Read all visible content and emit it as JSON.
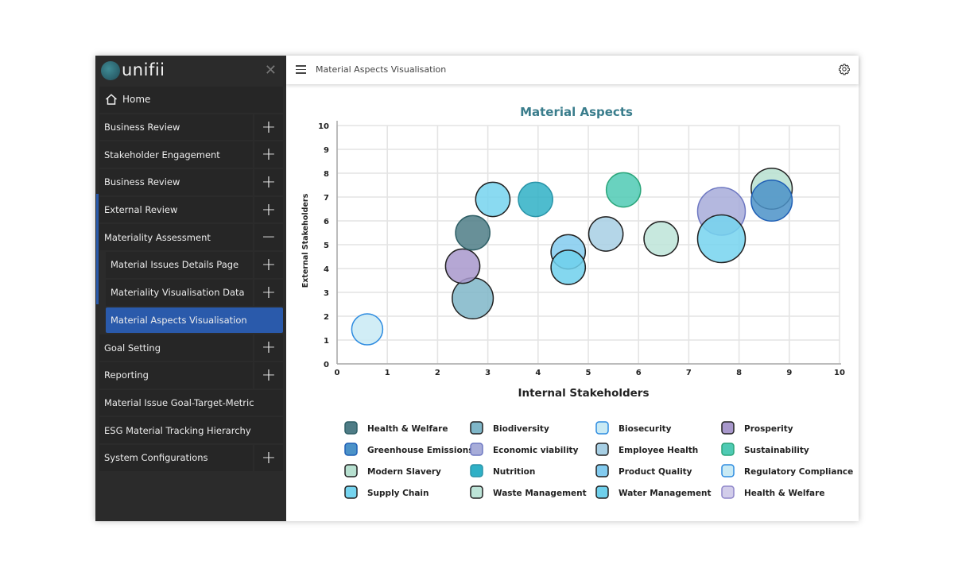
{
  "sidebar": {
    "brand": "unifii",
    "close_icon": "close-icon",
    "items": [
      {
        "label": "Home",
        "icon": "home-icon",
        "expander": null,
        "level": 0
      },
      {
        "label": "Business Review",
        "expander": "+",
        "level": 0
      },
      {
        "label": "Stakeholder Engagement",
        "expander": "+",
        "level": 0
      },
      {
        "label": "Business Review",
        "expander": "+",
        "level": 0
      },
      {
        "label": "External Review",
        "expander": "+",
        "level": 0
      },
      {
        "label": "Materiality Assessment",
        "expander": "−",
        "level": 0,
        "expanded": true
      },
      {
        "label": "Material Issues Details Page",
        "expander": "+",
        "level": 1
      },
      {
        "label": "Materiality Visualisation Data",
        "expander": "+",
        "level": 1
      },
      {
        "label": "Material Aspects Visualisation",
        "expander": null,
        "level": 1,
        "active": true
      },
      {
        "label": "Goal Setting",
        "expander": "+",
        "level": 0
      },
      {
        "label": "Reporting",
        "expander": "+",
        "level": 0
      },
      {
        "label": "Material Issue Goal-Target-Metric",
        "expander": null,
        "level": 0
      },
      {
        "label": "ESG Material Tracking Hierarchy",
        "expander": null,
        "level": 0
      },
      {
        "label": "System Configurations",
        "expander": "+",
        "level": 0
      }
    ]
  },
  "header": {
    "title": "Material Aspects Visualisation",
    "menu_icon": "hamburger-icon",
    "settings_icon": "gear-icon"
  },
  "colors": {
    "accent": "#2a5aab",
    "title": "#3a7d8c",
    "sidebar_bg": "#2b2b2b"
  },
  "chart_data": {
    "type": "bubble",
    "title": "Material Aspects",
    "xlabel": "Internal Stakeholders",
    "ylabel": "External Stakeholders",
    "xlim": [
      0,
      10
    ],
    "ylim": [
      0,
      10
    ],
    "xticks": [
      "0",
      "1",
      "2",
      "3",
      "4",
      "5",
      "6",
      "7",
      "8",
      "9",
      "10"
    ],
    "yticks": [
      "0",
      "1",
      "2",
      "3",
      "4",
      "5",
      "6",
      "7",
      "8",
      "9",
      "10"
    ],
    "grid": true,
    "legend_position": "bottom",
    "series": [
      {
        "name": "Health & Welfare",
        "fill": "#4e7c86",
        "stroke": "#2f5f66",
        "points": [
          {
            "x": 2.7,
            "y": 5.5,
            "size": 3
          }
        ]
      },
      {
        "name": "Biodiversity",
        "fill": "#7fb6c8",
        "stroke": "#222222",
        "points": [
          {
            "x": 2.7,
            "y": 2.75,
            "size": 4
          }
        ]
      },
      {
        "name": "Biosecurity",
        "fill": "#c9eaf4",
        "stroke": "#2d8be0",
        "points": []
      },
      {
        "name": "Prosperity",
        "fill": "#a898cc",
        "stroke": "#222222",
        "points": [
          {
            "x": 2.5,
            "y": 4.1,
            "size": 3
          }
        ]
      },
      {
        "name": "Greenhouse Emissions",
        "fill": "#4b92c8",
        "stroke": "#1f5fb5",
        "points": [
          {
            "x": 8.65,
            "y": 6.85,
            "size": 4
          }
        ]
      },
      {
        "name": "Economic viability",
        "fill": "#a7acd9",
        "stroke": "#6e78c2",
        "points": [
          {
            "x": 7.65,
            "y": 6.4,
            "size": 5
          }
        ]
      },
      {
        "name": "Employee Health",
        "fill": "#a7cfe4",
        "stroke": "#222222",
        "points": [
          {
            "x": 5.35,
            "y": 5.45,
            "size": 3
          }
        ]
      },
      {
        "name": "Sustainability",
        "fill": "#4fcab4",
        "stroke": "#2aa57a",
        "points": [
          {
            "x": 5.7,
            "y": 7.3,
            "size": 3
          }
        ]
      },
      {
        "name": "Modern Slavery",
        "fill": "#b7e0d0",
        "stroke": "#222222",
        "points": [
          {
            "x": 8.65,
            "y": 7.35,
            "size": 4
          }
        ]
      },
      {
        "name": "Nutrition",
        "fill": "#2fb0c6",
        "stroke": "#2a94a8",
        "points": [
          {
            "x": 3.95,
            "y": 6.9,
            "size": 3
          }
        ]
      },
      {
        "name": "Product Quality",
        "fill": "#83cbef",
        "stroke": "#222222",
        "points": [
          {
            "x": 4.6,
            "y": 4.7,
            "size": 3
          }
        ]
      },
      {
        "name": "Regulatory Compliance",
        "fill": "#c9eaf4",
        "stroke": "#2d8be0",
        "points": [
          {
            "x": 0.6,
            "y": 1.45,
            "size": 2.5
          }
        ]
      },
      {
        "name": "Supply Chain",
        "fill": "#75d4ef",
        "stroke": "#222222",
        "points": [
          {
            "x": 7.65,
            "y": 5.25,
            "size": 5
          },
          {
            "x": 3.1,
            "y": 6.9,
            "size": 3
          }
        ]
      },
      {
        "name": "Waste Management",
        "fill": "#bde4d8",
        "stroke": "#222222",
        "points": [
          {
            "x": 6.45,
            "y": 5.25,
            "size": 3
          }
        ]
      },
      {
        "name": "Water Management",
        "fill": "#6fd0ec",
        "stroke": "#222222",
        "points": [
          {
            "x": 4.6,
            "y": 4.05,
            "size": 3
          }
        ]
      },
      {
        "name": "Health & Welfare",
        "fill": "#d2cdea",
        "stroke": "#8f86c9",
        "points": []
      }
    ],
    "legend": [
      [
        "Health & Welfare",
        "Biodiversity",
        "Biosecurity",
        "Prosperity"
      ],
      [
        "Greenhouse Emissions",
        "Economic viability",
        "Employee Health",
        "Sustainability"
      ],
      [
        "Modern Slavery",
        "Nutrition",
        "Product Quality",
        "Regulatory Compliance"
      ],
      [
        "Supply Chain",
        "Waste Management",
        "Water Management",
        "Health & Welfare"
      ]
    ]
  }
}
